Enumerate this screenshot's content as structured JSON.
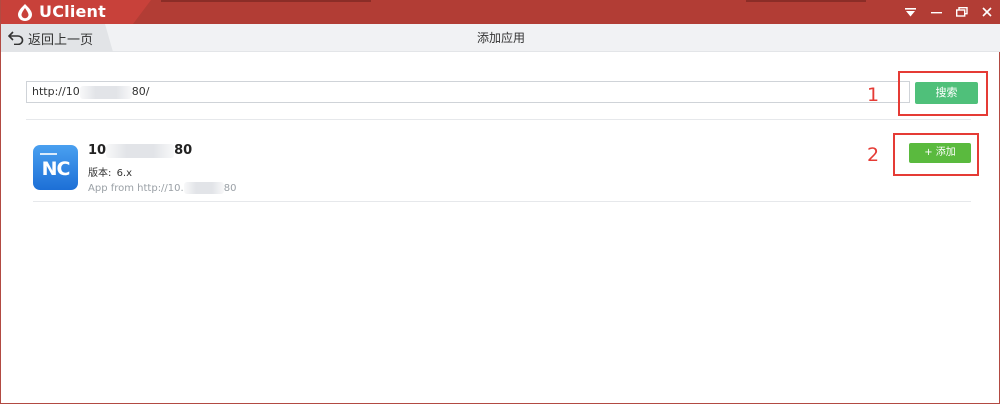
{
  "app": {
    "name": "UClient"
  },
  "window_controls": {
    "menu": "▼",
    "minimize": "—",
    "restore": "⧉",
    "close": "✕"
  },
  "nav": {
    "back_label": "返回上一页",
    "title": "添加应用"
  },
  "search": {
    "value_prefix": "http://10",
    "value_suffix": "80/",
    "button_label": "搜索"
  },
  "result": {
    "icon_text": "NC",
    "title_prefix": "10",
    "title_suffix": "80",
    "version_label": "版本:",
    "version_value": "6.x",
    "source_prefix": "App from http://10.",
    "source_suffix": "80",
    "add_label": "+ 添加"
  },
  "annotations": {
    "one": "1",
    "two": "2"
  },
  "colors": {
    "titlebar": "#b23d35",
    "search_button": "#4fc07a",
    "add_button": "#5aba3e",
    "annotation": "#e53b35"
  }
}
